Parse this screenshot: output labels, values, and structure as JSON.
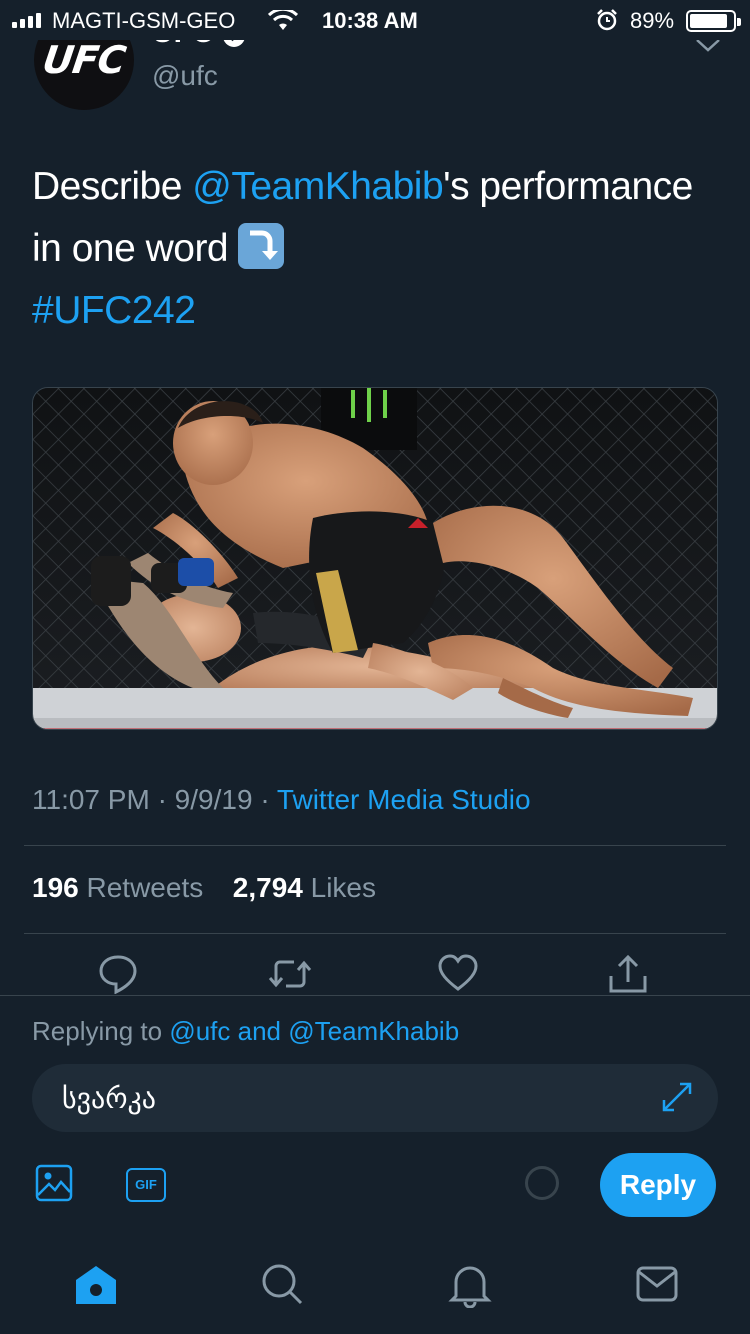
{
  "status_bar": {
    "carrier": "MAGTI-GSM-GEO",
    "time": "10:38 AM",
    "battery_percent": "89%",
    "battery_level": 0.89
  },
  "tweet": {
    "display_name": "UFC",
    "handle": "@ufc",
    "avatar_logo": "UFC",
    "text_before": "Describe ",
    "mention": "@TeamKhabib",
    "text_after": "'s performance in one word ",
    "emoji": "arrow-down-right-emoji",
    "hashtag": "#UFC242",
    "time": "11:07 PM",
    "date": "9/9/19",
    "source": "Twitter Media Studio",
    "retweets": "196",
    "retweets_label": "Retweets",
    "likes": "2,794",
    "likes_label": "Likes"
  },
  "composer": {
    "replying_prefix": "Replying to ",
    "replying_mention1": "@ufc",
    "replying_and": " and ",
    "replying_mention2": "@TeamKhabib",
    "input_value": "სვარკა",
    "gif_label": "GIF",
    "reply_button": "Reply"
  },
  "icons": {
    "actions": [
      "reply-icon",
      "retweet-icon",
      "like-icon",
      "share-icon"
    ],
    "tabs": [
      "home-icon",
      "search-icon",
      "notifications-icon",
      "messages-icon"
    ]
  },
  "colors": {
    "background": "#15202b",
    "accent": "#1da1f2",
    "secondary_text": "#8899a6",
    "divider": "#38444d"
  }
}
